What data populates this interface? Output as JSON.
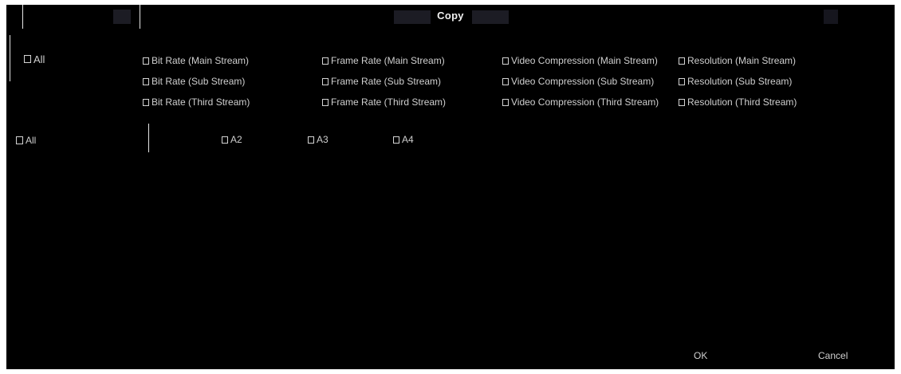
{
  "dialog": {
    "title": "Copy",
    "ok_label": "OK",
    "cancel_label": "Cancel"
  },
  "params": {
    "all_label": "All",
    "options": [
      "Bit Rate (Main Stream)",
      "Frame Rate (Main Stream)",
      "Video Compression (Main Stream)",
      "Resolution (Main Stream)",
      "Bit Rate (Sub Stream)",
      "Frame Rate (Sub Stream)",
      "Video Compression (Sub Stream)",
      "Resolution (Sub Stream)",
      "Bit Rate (Third Stream)",
      "Frame Rate (Third Stream)",
      "Video Compression (Third Stream)",
      "Resolution (Third Stream)"
    ]
  },
  "channels": {
    "all_label": "All",
    "items": [
      "A2",
      "A3",
      "A4"
    ]
  },
  "colors": {
    "background": "#000000",
    "text": "#d0d0d0",
    "divider": "#e6e6e6"
  }
}
